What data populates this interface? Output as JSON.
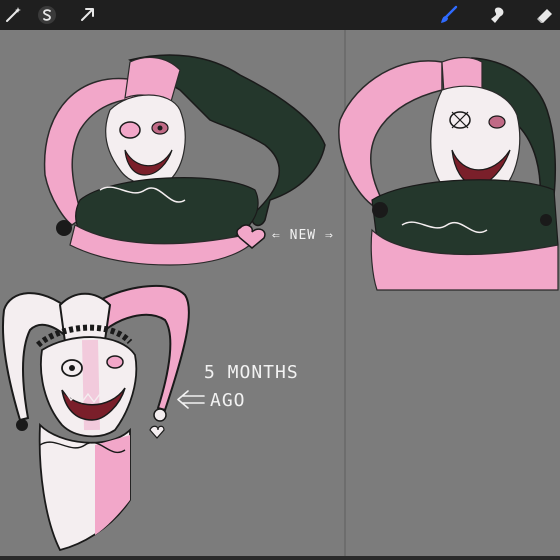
{
  "toolbar": {
    "left_tools": [
      {
        "icon": "magic-wand-icon",
        "name": "Adjustments"
      },
      {
        "icon": "selection-s-icon",
        "name": "Selection"
      },
      {
        "icon": "transform-arrow-icon",
        "name": "Transform"
      }
    ],
    "right_tools": [
      {
        "icon": "brush-icon",
        "name": "Paint",
        "active": true
      },
      {
        "icon": "smudge-icon",
        "name": "Smudge"
      },
      {
        "icon": "eraser-icon",
        "name": "Eraser"
      }
    ],
    "colors": {
      "bar": "#1f1f1f",
      "active": "#2f6bff",
      "icon": "#e8e8e8"
    }
  },
  "canvas": {
    "background": "#7c7c7c",
    "annotations": {
      "new_label": "⇐ NEW ⇒",
      "ago_line1": "5 MONTHS",
      "ago_line2": "AGO"
    }
  },
  "art_colors": {
    "pink": "#f2a7c9",
    "green": "#24372c",
    "white": "#f4eef0",
    "dark": "#1a1a1a"
  }
}
